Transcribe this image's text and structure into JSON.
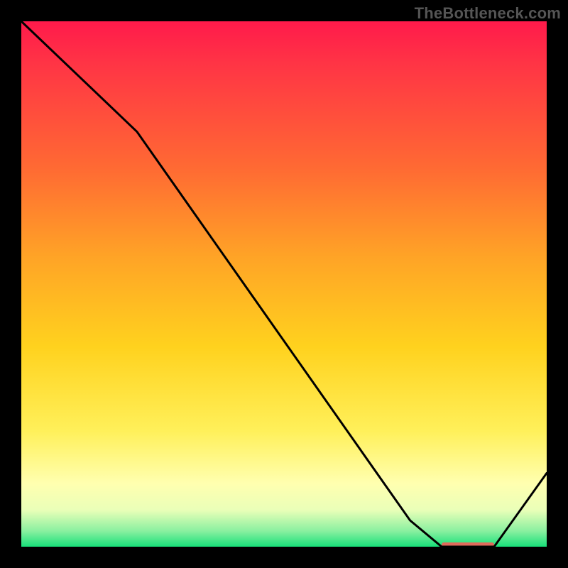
{
  "watermark": "TheBottleneck.com",
  "chart_data": {
    "type": "line",
    "title": "",
    "xlabel": "",
    "ylabel": "",
    "xlim": [
      0,
      100
    ],
    "ylim": [
      0,
      100
    ],
    "x": [
      0,
      22,
      74,
      80,
      90,
      100
    ],
    "values": [
      100,
      79,
      5,
      0,
      0,
      14
    ],
    "optimal_range": {
      "x_start": 80,
      "x_end": 90,
      "y": 0
    },
    "gradient_stops": [
      {
        "pos": 0,
        "color": "#ff1a4b"
      },
      {
        "pos": 28,
        "color": "#ff6a33"
      },
      {
        "pos": 62,
        "color": "#ffd21e"
      },
      {
        "pos": 88,
        "color": "#ffffb0"
      },
      {
        "pos": 100,
        "color": "#18e07a"
      }
    ],
    "annotations": []
  }
}
